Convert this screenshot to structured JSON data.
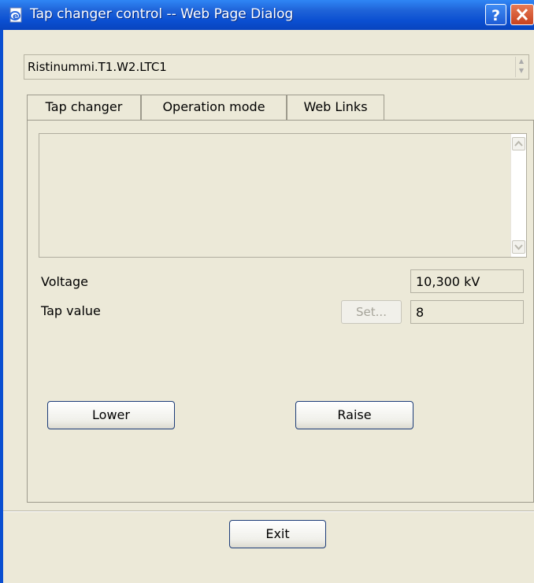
{
  "window": {
    "title": "Tap changer control -- Web Page Dialog"
  },
  "object": {
    "name": "Ristinummi.T1.W2.LTC1"
  },
  "tabs": [
    {
      "label": "Tap changer"
    },
    {
      "label": "Operation mode"
    },
    {
      "label": "Web Links"
    }
  ],
  "fields": {
    "voltage_label": "Voltage",
    "voltage_value": "10,300 kV",
    "tap_label": "Tap value",
    "tap_value": "8",
    "set_label": "Set..."
  },
  "buttons": {
    "lower": "Lower",
    "raise": "Raise",
    "exit": "Exit"
  }
}
